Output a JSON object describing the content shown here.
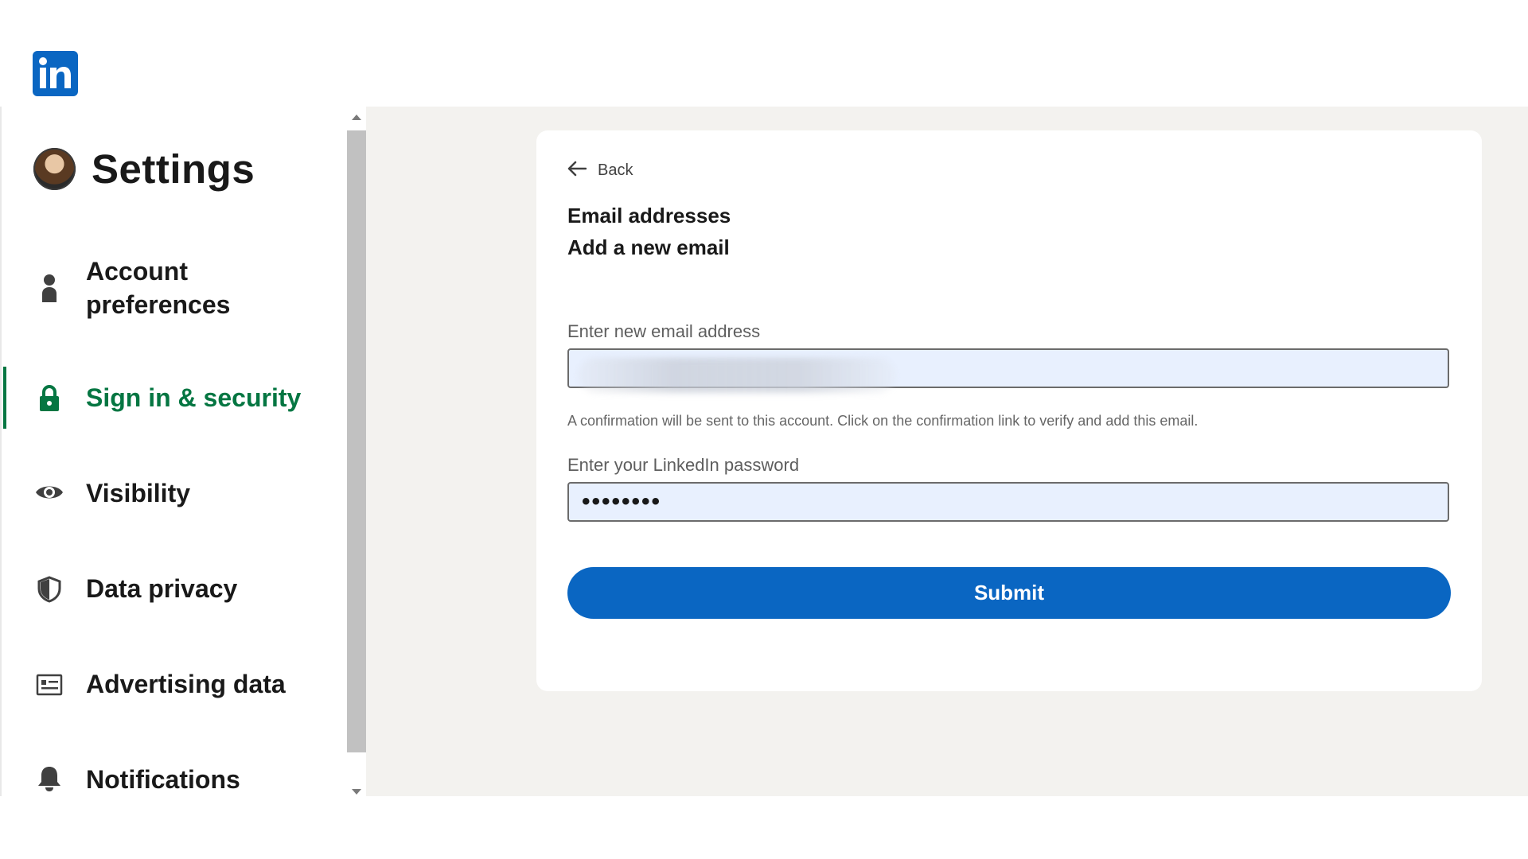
{
  "header": {
    "logo_text": "in",
    "logo_icon": "linkedin-logo-icon",
    "brand_color": "#0a66c2"
  },
  "sidebar": {
    "title": "Settings",
    "active_color": "#057642",
    "items": [
      {
        "label_line1": "Account",
        "label_line2": "preferences",
        "icon": "person-icon"
      },
      {
        "label": "Sign in & security",
        "icon": "lock-icon",
        "active": true
      },
      {
        "label": "Visibility",
        "icon": "eye-icon"
      },
      {
        "label": "Data privacy",
        "icon": "shield-icon"
      },
      {
        "label": "Advertising data",
        "icon": "ad-list-icon"
      },
      {
        "label": "Notifications",
        "icon": "bell-icon"
      }
    ]
  },
  "main": {
    "back_label": "Back",
    "title": "Email addresses",
    "subtitle": "Add a new email",
    "email_label": "Enter new email address",
    "email_value": "",
    "helper_text": "A confirmation will be sent to this account. Click on the confirmation link to verify and add this email.",
    "password_label": "Enter your LinkedIn password",
    "password_value": "••••••••",
    "submit_label": "Submit",
    "field_fill_color": "#e8f0fe"
  }
}
